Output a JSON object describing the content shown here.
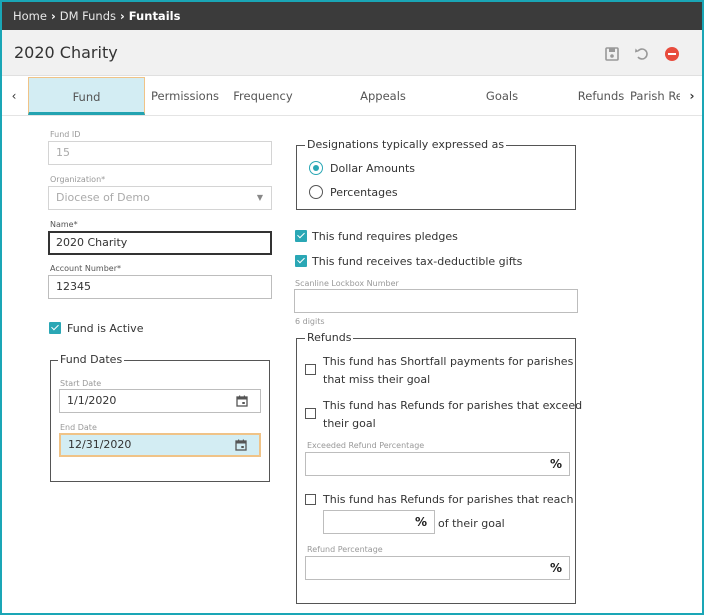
{
  "breadcrumb": {
    "items": [
      "Home",
      "DM Funds",
      "Fun"
    ],
    "current_suffix": "tails"
  },
  "header": {
    "title": "2020 Charity"
  },
  "tabs": [
    "Fund",
    "Permissions",
    "Frequency",
    "Appeals",
    "Goals",
    "Refunds",
    "Parish Re"
  ],
  "form": {
    "fund_id": {
      "label": "Fund ID",
      "value": "15"
    },
    "organization": {
      "label": "Organization*",
      "value": "Diocese of Demo"
    },
    "name": {
      "label": "Name*",
      "value": "2020 Charity"
    },
    "account_number": {
      "label": "Account Number*",
      "value": "12345"
    },
    "fund_active_label": "Fund is Active",
    "fund_dates": {
      "legend": "Fund Dates",
      "start_label": "Start Date",
      "start_value": "1/1/2020",
      "end_label": "End Date",
      "end_value": "12/31/2020"
    },
    "designations": {
      "legend": "Designations typically expressed as",
      "options": [
        "Dollar Amounts",
        "Percentages"
      ],
      "selected": "Dollar Amounts"
    },
    "requires_pledges_label": "This fund requires pledges",
    "tax_deductible_label": "This fund receives tax-deductible gifts",
    "scanline": {
      "label": "Scanline Lockbox Number",
      "value": "",
      "hint": "6 digits"
    },
    "refunds": {
      "legend": "Refunds",
      "shortfall_line1": "This fund has Shortfall payments for parishes",
      "shortfall_line2": "that miss their goal",
      "exceed_line1": "This fund has Refunds for parishes that exceed",
      "exceed_line2": "their goal",
      "exceeded_pct_label": "Exceeded Refund Percentage",
      "reach_line1": "This fund has Refunds for parishes that reach",
      "reach_suffix": "of their goal",
      "refund_pct_label": "Refund Percentage",
      "percent_symbol": "%"
    }
  }
}
